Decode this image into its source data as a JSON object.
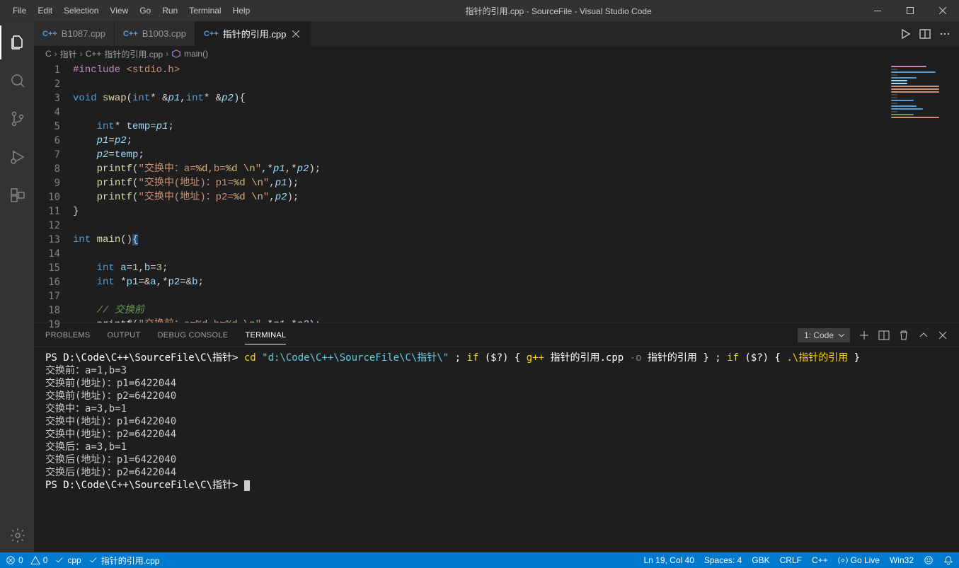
{
  "title": "指针的引用.cpp - SourceFile - Visual Studio Code",
  "menus": [
    "File",
    "Edit",
    "Selection",
    "View",
    "Go",
    "Run",
    "Terminal",
    "Help"
  ],
  "tabs": [
    {
      "label": "B1087.cpp",
      "active": false
    },
    {
      "label": "B1003.cpp",
      "active": false
    },
    {
      "label": "指针的引用.cpp",
      "active": true
    }
  ],
  "breadcrumbs": {
    "parts": [
      "C",
      "指针",
      "指针的引用.cpp",
      "main()"
    ]
  },
  "panel": {
    "tabs": [
      "PROBLEMS",
      "OUTPUT",
      "DEBUG CONSOLE",
      "TERMINAL"
    ],
    "active": 3,
    "selector": "1: Code"
  },
  "terminal": {
    "prompt1_head": "PS D:\\Code\\C++\\SourceFile\\C\\指针> ",
    "cmd_cd": "cd",
    "cmd_path": " \"d:\\Code\\C++\\SourceFile\\C\\指针\\\" ",
    "cmd_semi1": "; ",
    "cmd_if": "if",
    "cmd_dq": " ($?) ",
    "cmd_brace_o": "{ ",
    "cmd_gpp": "g++",
    "cmd_src": " 指针的引用.cpp ",
    "cmd_o": "-o",
    "cmd_out": " 指针的引用 ",
    "cmd_brace_c": "} ",
    "cmd_semi2": "; ",
    "cmd_if2": "if",
    "cmd_dq2": " ($?) ",
    "cmd_brace_o2": "{ ",
    "cmd_exec": ".\\指针的引用",
    "cmd_brace_c2": " }",
    "lines": [
      "交换前：a=1,b=3",
      "交换前(地址)：p1=6422044",
      "交换前(地址)：p2=6422040",
      "交换中：a=3,b=1",
      "交换中(地址)：p1=6422040",
      "交换中(地址)：p2=6422044",
      "交换后：a=3,b=1",
      "交换后(地址)：p1=6422040",
      "交换后(地址)：p2=6422044"
    ],
    "prompt2": "PS D:\\Code\\C++\\SourceFile\\C\\指针> "
  },
  "statusbar": {
    "errors": "0",
    "warnings": "0",
    "lang_check": "cpp",
    "file_check": "指针的引用.cpp",
    "cursor": "Ln 19, Col 40",
    "spaces": "Spaces: 4",
    "encoding": "GBK",
    "eol": "CRLF",
    "language": "C++",
    "golive": "Go Live",
    "platform": "Win32"
  },
  "code": {
    "line_count": 19
  }
}
